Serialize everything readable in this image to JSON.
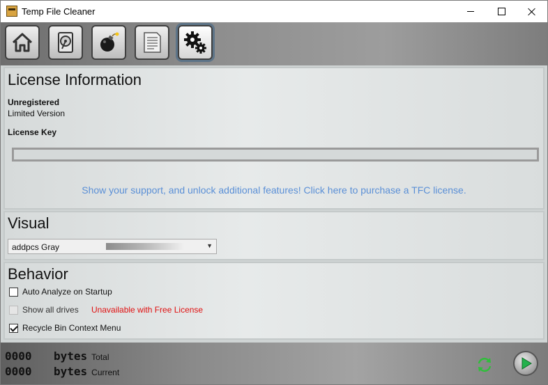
{
  "window": {
    "title": "Temp File Cleaner",
    "icon": "tfc-app-icon"
  },
  "toolbar": {
    "buttons": [
      {
        "icon": "home-icon"
      },
      {
        "icon": "hard-drive-icon"
      },
      {
        "icon": "bomb-icon"
      },
      {
        "icon": "log-document-icon"
      },
      {
        "icon": "settings-gears-icon",
        "active": true
      }
    ]
  },
  "license": {
    "heading": "License Information",
    "status": "Unregistered",
    "version": "Limited Version",
    "key_label": "License Key",
    "key_value": "",
    "purchase_link": "Show your support, and unlock additional features! Click here to purchase a TFC license."
  },
  "visual": {
    "heading": "Visual",
    "theme_selected": "addpcs Gray"
  },
  "behavior": {
    "heading": "Behavior",
    "options": [
      {
        "label": "Auto Analyze on Startup",
        "checked": false,
        "enabled": true
      },
      {
        "label": "Show all drives",
        "checked": false,
        "enabled": false,
        "note": "Unavailable with Free License"
      },
      {
        "label": "Recycle Bin Context Menu",
        "checked": true,
        "enabled": true
      }
    ]
  },
  "status": {
    "total": {
      "value": "0000",
      "unit": "bytes",
      "label": "Total"
    },
    "current": {
      "value": "0000",
      "unit": "bytes",
      "label": "Current"
    }
  },
  "colors": {
    "link": "#5a8fd6",
    "warning": "#e01010",
    "active_tab_outline": "#5d7488",
    "refresh_green": "#2fbf3a",
    "play_green": "#22b14c"
  }
}
